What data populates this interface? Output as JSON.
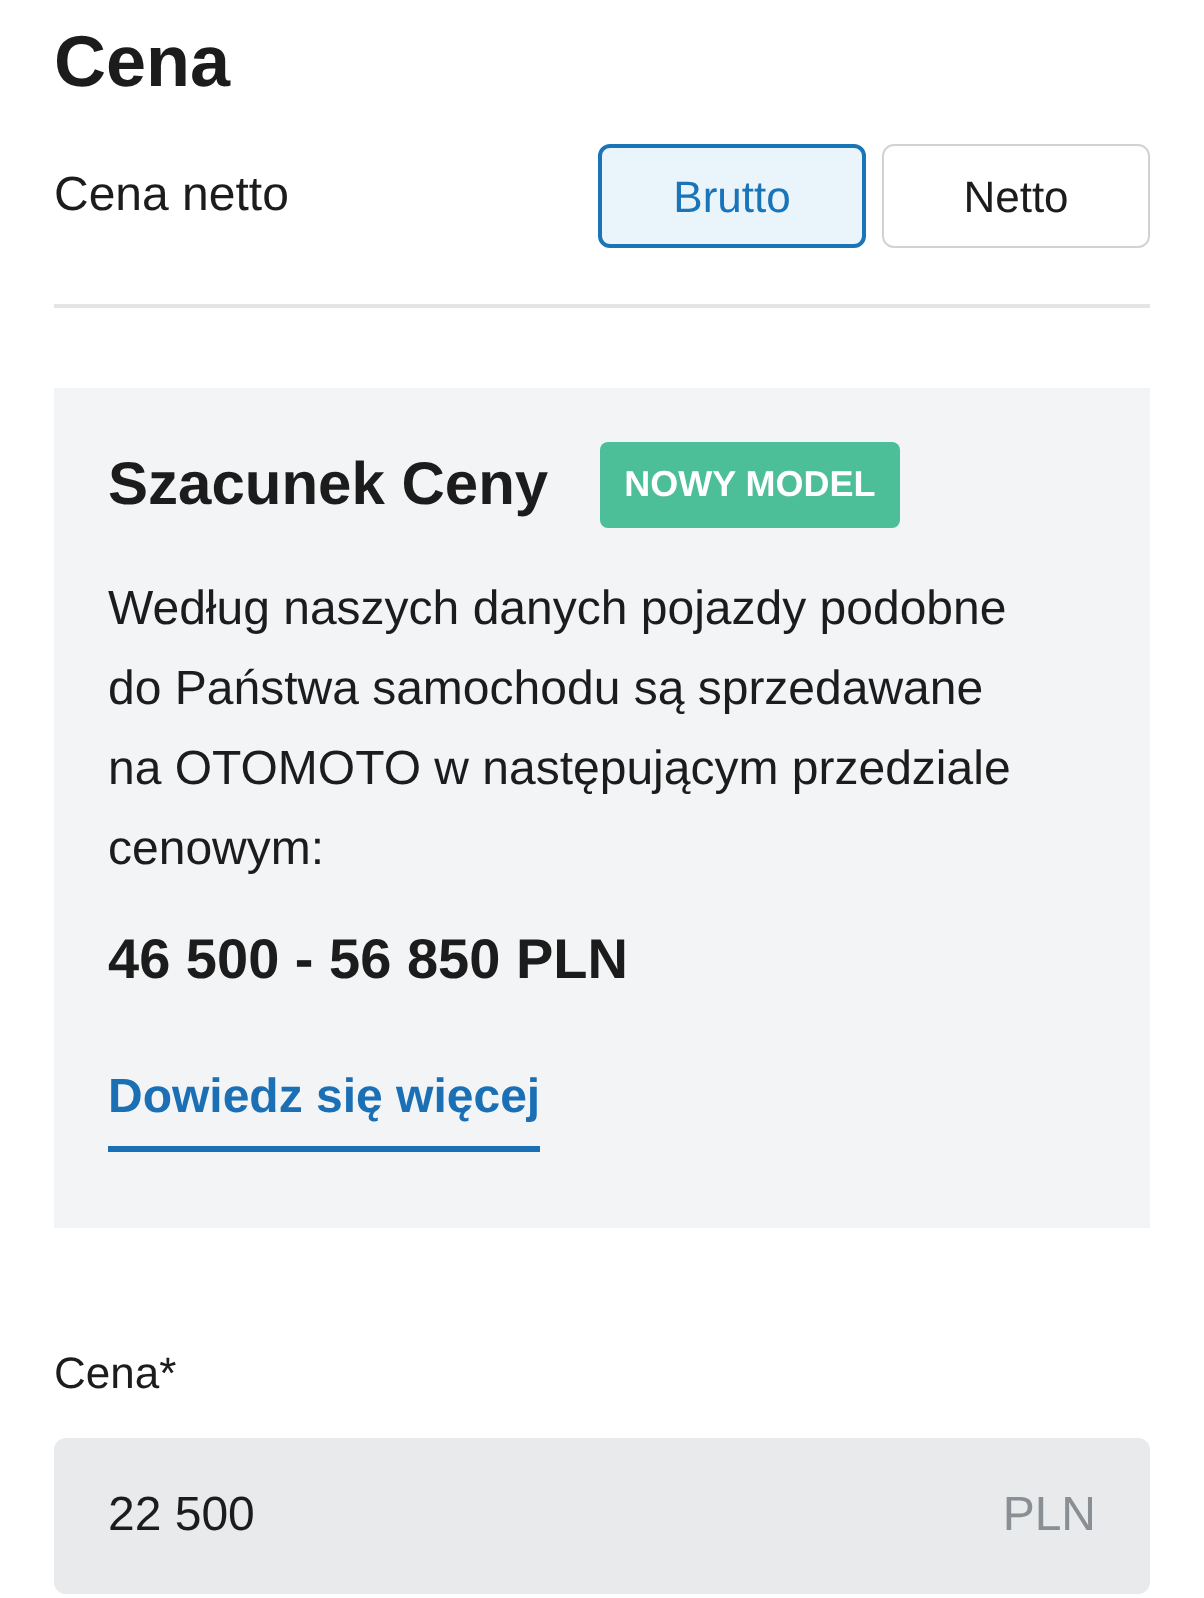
{
  "heading": "Cena",
  "price_type": {
    "label": "Cena netto",
    "options": [
      {
        "label": "Brutto",
        "selected": true
      },
      {
        "label": "Netto",
        "selected": false
      }
    ]
  },
  "estimate": {
    "title": "Szacunek Ceny",
    "badge": "NOWY MODEL",
    "description": "Według naszych danych pojazdy podobne do Państwa samochodu są sprzedawane na OTOMOTO w następującym przedziale cenowym:",
    "range": "46 500 - 56 850 PLN",
    "link": "Dowiedz się więcej"
  },
  "price_field": {
    "label": "Cena*",
    "value": "22 500",
    "unit": "PLN"
  }
}
